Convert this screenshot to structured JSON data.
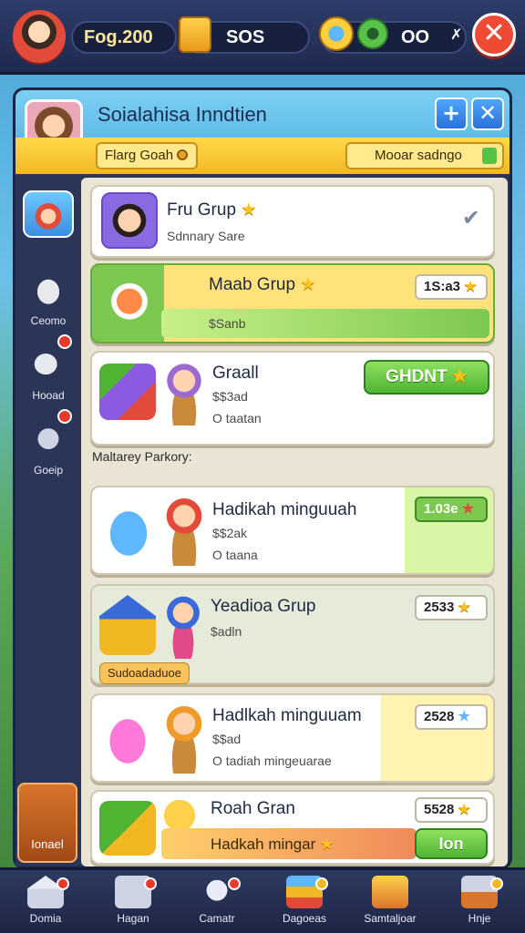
{
  "topbar": {
    "currency1": "Fog.200",
    "currency2": "SOS",
    "currency3": "OO",
    "small_x": "✗",
    "close_glyph": "✕"
  },
  "panel": {
    "title": "Soialahisa Inndtien",
    "add_glyph": "+",
    "close_glyph": "✕",
    "tab_left": "Flarg Goah",
    "tab_right": "Mooar sadngo"
  },
  "sidebar": {
    "items": [
      {
        "label": ""
      },
      {
        "label": "Ceomo"
      },
      {
        "label": "Hooad"
      },
      {
        "label": "Goeip"
      }
    ],
    "bottom_label": "Ionael"
  },
  "list": {
    "section_label": "Maltarey Parkory:",
    "cards": [
      {
        "name": "Fru Grup",
        "sub": "Sdnnary Sare",
        "status": "✔"
      },
      {
        "name": "Maab Grup",
        "sub": "$Sanb",
        "badge": "1S:a3"
      },
      {
        "name": "Graall",
        "sub1": "$$3ad",
        "sub2": "O taatan",
        "button": "GHDNT"
      },
      {
        "name": "Hadikah minguuah",
        "sub1": "$$2ak",
        "sub2": "O taana",
        "badge": "1.03e"
      },
      {
        "name": "Yeadioa Grup",
        "sub": "$adln",
        "badge": "2533",
        "tag": "Sudoadaduoe"
      },
      {
        "name": "Hadlkah minguuam",
        "sub1": "$$ad",
        "sub2": "O tadiah mingeuarae",
        "badge": "2528"
      },
      {
        "name": "Roah Gran",
        "sub": "Hadkah mingar",
        "badge": "5528",
        "button": "Ion"
      }
    ]
  },
  "bottomnav": {
    "items": [
      {
        "label": "Domia"
      },
      {
        "label": "Hagan"
      },
      {
        "label": "Camatr"
      },
      {
        "label": "Dagoeas"
      },
      {
        "label": "Samtaljoar"
      },
      {
        "label": "Hnje"
      }
    ]
  },
  "colors": {
    "accent_yellow": "#f2b824",
    "accent_blue": "#4aaee0",
    "accent_green": "#4fb432",
    "close_red": "#f04a35"
  }
}
